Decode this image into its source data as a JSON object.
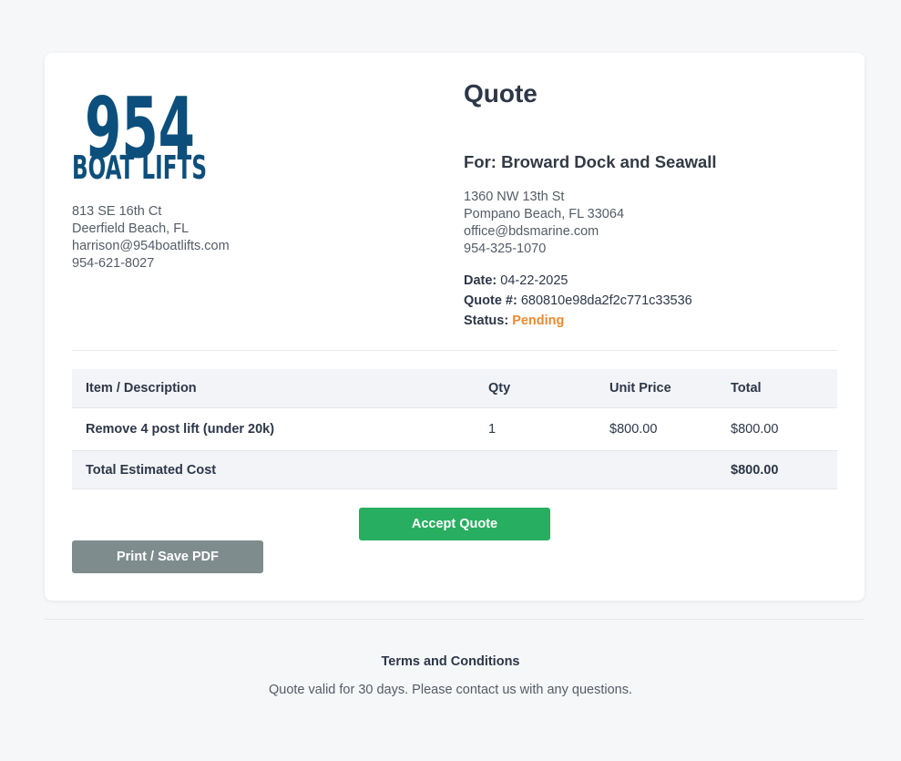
{
  "company": {
    "logo_top": "954",
    "logo_bottom": "BOAT LIFTS",
    "address_line1": "813 SE 16th Ct",
    "address_line2": "Deerfield Beach, FL",
    "email": "harrison@954boatlifts.com",
    "phone": "954-621-8027",
    "brand_color": "#0d4f7c"
  },
  "quote": {
    "title": "Quote",
    "for_heading": "For: Broward Dock and Seawall",
    "client_address_line1": "1360 NW 13th St",
    "client_address_line2": "Pompano Beach, FL 33064",
    "client_email": "office@bdsmarine.com",
    "client_phone": "954-325-1070",
    "date_label": "Date:",
    "date_value": "04-22-2025",
    "number_label": "Quote #:",
    "number_value": "680810e98da2f2c771c33536",
    "status_label": "Status:",
    "status_value": "Pending",
    "status_color": "#e98a2e"
  },
  "table": {
    "headers": {
      "description": "Item / Description",
      "qty": "Qty",
      "unit_price": "Unit Price",
      "total": "Total"
    },
    "rows": [
      {
        "description": "Remove 4 post lift (under 20k)",
        "qty": "1",
        "unit_price": "$800.00",
        "total": "$800.00"
      }
    ],
    "total_label": "Total Estimated Cost",
    "total_value": "$800.00"
  },
  "actions": {
    "accept_label": "Accept Quote",
    "print_label": "Print / Save PDF",
    "accept_color": "#27ae60",
    "print_color": "#7f8c8d"
  },
  "footer": {
    "terms_title": "Terms and Conditions",
    "terms_text": "Quote valid for 30 days. Please contact us with any questions."
  }
}
